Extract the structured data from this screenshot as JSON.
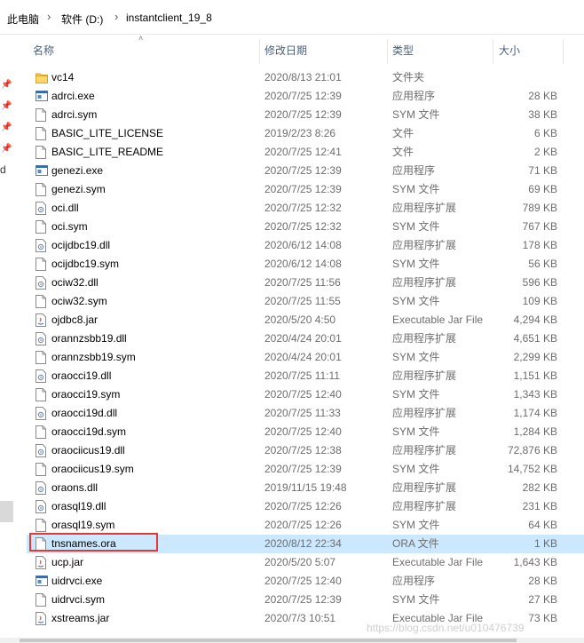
{
  "breadcrumb": {
    "items": [
      "此电脑",
      "软件 (D:)",
      "instantclient_19_8"
    ],
    "separator": "›"
  },
  "left_pane": {
    "text": "d"
  },
  "columns": {
    "name": "名称",
    "date": "修改日期",
    "type": "类型",
    "size": "大小"
  },
  "files": [
    {
      "name": "vc14",
      "date": "2020/8/13 21:01",
      "type": "文件夹",
      "size": "",
      "icon": "folder-icon"
    },
    {
      "name": "adrci.exe",
      "date": "2020/7/25 12:39",
      "type": "应用程序",
      "size": "28 KB",
      "icon": "exe-icon"
    },
    {
      "name": "adrci.sym",
      "date": "2020/7/25 12:39",
      "type": "SYM 文件",
      "size": "38 KB",
      "icon": "file-icon"
    },
    {
      "name": "BASIC_LITE_LICENSE",
      "date": "2019/2/23 8:26",
      "type": "文件",
      "size": "6 KB",
      "icon": "file-icon"
    },
    {
      "name": "BASIC_LITE_README",
      "date": "2020/7/25 12:41",
      "type": "文件",
      "size": "2 KB",
      "icon": "file-icon"
    },
    {
      "name": "genezi.exe",
      "date": "2020/7/25 12:39",
      "type": "应用程序",
      "size": "71 KB",
      "icon": "exe-icon"
    },
    {
      "name": "genezi.sym",
      "date": "2020/7/25 12:39",
      "type": "SYM 文件",
      "size": "69 KB",
      "icon": "file-icon"
    },
    {
      "name": "oci.dll",
      "date": "2020/7/25 12:32",
      "type": "应用程序扩展",
      "size": "789 KB",
      "icon": "dll-icon"
    },
    {
      "name": "oci.sym",
      "date": "2020/7/25 12:32",
      "type": "SYM 文件",
      "size": "767 KB",
      "icon": "file-icon"
    },
    {
      "name": "ocijdbc19.dll",
      "date": "2020/6/12 14:08",
      "type": "应用程序扩展",
      "size": "178 KB",
      "icon": "dll-icon"
    },
    {
      "name": "ocijdbc19.sym",
      "date": "2020/6/12 14:08",
      "type": "SYM 文件",
      "size": "56 KB",
      "icon": "file-icon"
    },
    {
      "name": "ociw32.dll",
      "date": "2020/7/25 11:56",
      "type": "应用程序扩展",
      "size": "596 KB",
      "icon": "dll-icon"
    },
    {
      "name": "ociw32.sym",
      "date": "2020/7/25 11:55",
      "type": "SYM 文件",
      "size": "109 KB",
      "icon": "file-icon"
    },
    {
      "name": "ojdbc8.jar",
      "date": "2020/5/20 4:50",
      "type": "Executable Jar File",
      "size": "4,294 KB",
      "icon": "jar-icon"
    },
    {
      "name": "orannzsbb19.dll",
      "date": "2020/4/24 20:01",
      "type": "应用程序扩展",
      "size": "4,651 KB",
      "icon": "dll-icon"
    },
    {
      "name": "orannzsbb19.sym",
      "date": "2020/4/24 20:01",
      "type": "SYM 文件",
      "size": "2,299 KB",
      "icon": "file-icon"
    },
    {
      "name": "oraocci19.dll",
      "date": "2020/7/25 11:11",
      "type": "应用程序扩展",
      "size": "1,151 KB",
      "icon": "dll-icon"
    },
    {
      "name": "oraocci19.sym",
      "date": "2020/7/25 12:40",
      "type": "SYM 文件",
      "size": "1,343 KB",
      "icon": "file-icon"
    },
    {
      "name": "oraocci19d.dll",
      "date": "2020/7/25 11:33",
      "type": "应用程序扩展",
      "size": "1,174 KB",
      "icon": "dll-icon"
    },
    {
      "name": "oraocci19d.sym",
      "date": "2020/7/25 12:40",
      "type": "SYM 文件",
      "size": "1,284 KB",
      "icon": "file-icon"
    },
    {
      "name": "oraociicus19.dll",
      "date": "2020/7/25 12:38",
      "type": "应用程序扩展",
      "size": "72,876 KB",
      "icon": "dll-icon"
    },
    {
      "name": "oraociicus19.sym",
      "date": "2020/7/25 12:39",
      "type": "SYM 文件",
      "size": "14,752 KB",
      "icon": "file-icon"
    },
    {
      "name": "oraons.dll",
      "date": "2019/11/15 19:48",
      "type": "应用程序扩展",
      "size": "282 KB",
      "icon": "dll-icon"
    },
    {
      "name": "orasql19.dll",
      "date": "2020/7/25 12:26",
      "type": "应用程序扩展",
      "size": "231 KB",
      "icon": "dll-icon"
    },
    {
      "name": "orasql19.sym",
      "date": "2020/7/25 12:26",
      "type": "SYM 文件",
      "size": "64 KB",
      "icon": "file-icon"
    },
    {
      "name": "tnsnames.ora",
      "date": "2020/8/12 22:34",
      "type": "ORA 文件",
      "size": "1 KB",
      "icon": "file-icon",
      "selected": true
    },
    {
      "name": "ucp.jar",
      "date": "2020/5/20 5:07",
      "type": "Executable Jar File",
      "size": "1,643 KB",
      "icon": "jar-icon"
    },
    {
      "name": "uidrvci.exe",
      "date": "2020/7/25 12:40",
      "type": "应用程序",
      "size": "28 KB",
      "icon": "exe-icon"
    },
    {
      "name": "uidrvci.sym",
      "date": "2020/7/25 12:39",
      "type": "SYM 文件",
      "size": "27 KB",
      "icon": "file-icon"
    },
    {
      "name": "xstreams.jar",
      "date": "2020/7/3 10:51",
      "type": "Executable Jar File",
      "size": "73 KB",
      "icon": "jar-icon"
    }
  ],
  "watermark": "https://blog.csdn.net/u010476739",
  "colors": {
    "selection": "#cce8ff",
    "highlight_box": "#e53935",
    "folder": "#f7c646",
    "header_text": "#4c607a"
  }
}
